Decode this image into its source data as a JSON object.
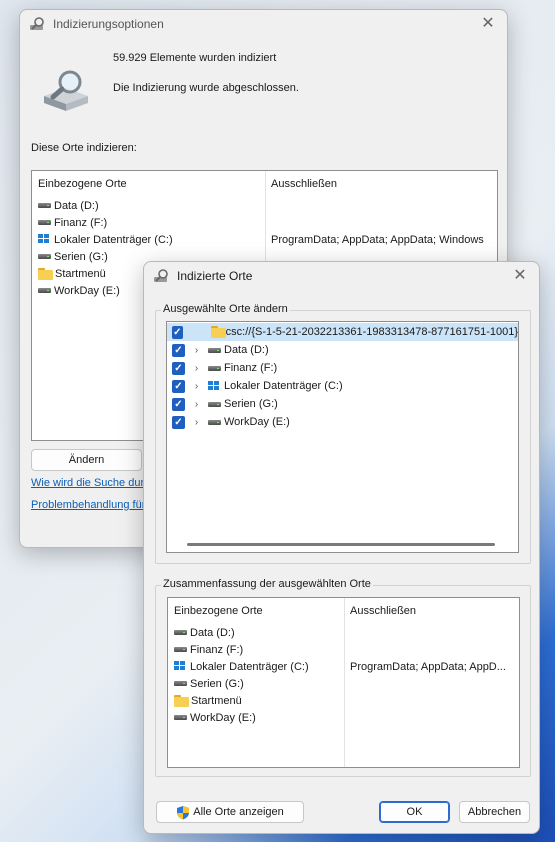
{
  "main_window": {
    "title": "Indizierungsoptionen",
    "indexed_count": "59.929 Elemente wurden indiziert",
    "status": "Die Indizierung wurde abgeschlossen.",
    "section_label": "Diese Orte indizieren:",
    "columns": {
      "included": "Einbezogene Orte",
      "exclude": "Ausschließen"
    },
    "rows": [
      {
        "icon": "drive-icon",
        "label": "Data (D:)",
        "exclude": ""
      },
      {
        "icon": "drive-icon",
        "label": "Finanz (F:)",
        "exclude": ""
      },
      {
        "icon": "system-drive-icon",
        "label": "Lokaler Datenträger (C:)",
        "exclude": "ProgramData; AppData; AppData; Windows"
      },
      {
        "icon": "drive-icon",
        "label": "Serien (G:)",
        "exclude": ""
      },
      {
        "icon": "folder-icon",
        "label": "Startmenü",
        "exclude": ""
      },
      {
        "icon": "drive-icon",
        "label": "WorkDay (E:)",
        "exclude": ""
      }
    ],
    "change_button": "Ändern",
    "link_search": "Wie wird die Suche durc",
    "link_troubleshoot": "Problembehandlung für"
  },
  "dialog": {
    "title": "Indizierte Orte",
    "change_group_label": "Ausgewählte Orte ändern",
    "tree": [
      {
        "checked": true,
        "expandable": false,
        "icon": "folder-icon",
        "label": "csc://{S-1-5-21-2032213361-1983313478-877161751-1001}",
        "selected": true
      },
      {
        "checked": true,
        "expandable": true,
        "icon": "drive-icon",
        "label": "Data (D:)",
        "selected": false
      },
      {
        "checked": true,
        "expandable": true,
        "icon": "drive-icon",
        "label": "Finanz (F:)",
        "selected": false
      },
      {
        "checked": true,
        "expandable": true,
        "icon": "system-drive-icon",
        "label": "Lokaler Datenträger (C:)",
        "selected": false
      },
      {
        "checked": true,
        "expandable": true,
        "icon": "drive-icon",
        "label": "Serien (G:)",
        "selected": false
      },
      {
        "checked": true,
        "expandable": true,
        "icon": "drive-icon",
        "label": "WorkDay (E:)",
        "selected": false
      }
    ],
    "summary_group_label": "Zusammenfassung der ausgewählten Orte",
    "summary_columns": {
      "included": "Einbezogene Orte",
      "exclude": "Ausschließen"
    },
    "summary_rows": [
      {
        "icon": "drive-icon",
        "label": "Data (D:)",
        "exclude": ""
      },
      {
        "icon": "drive-icon",
        "label": "Finanz (F:)",
        "exclude": ""
      },
      {
        "icon": "system-drive-icon",
        "label": "Lokaler Datenträger (C:)",
        "exclude": "ProgramData; AppData; AppD..."
      },
      {
        "icon": "drive-icon",
        "label": "Serien (G:)",
        "exclude": ""
      },
      {
        "icon": "folder-icon",
        "label": "Startmenü",
        "exclude": ""
      },
      {
        "icon": "drive-icon",
        "label": "WorkDay (E:)",
        "exclude": ""
      }
    ],
    "show_all_button": "Alle Orte anzeigen",
    "ok_button": "OK",
    "cancel_button": "Abbrechen"
  },
  "colors": {
    "accent": "#2d6bd2",
    "checkbox": "#1f5fbf",
    "link": "#0b5fb5",
    "selection": "#cce4f7"
  }
}
